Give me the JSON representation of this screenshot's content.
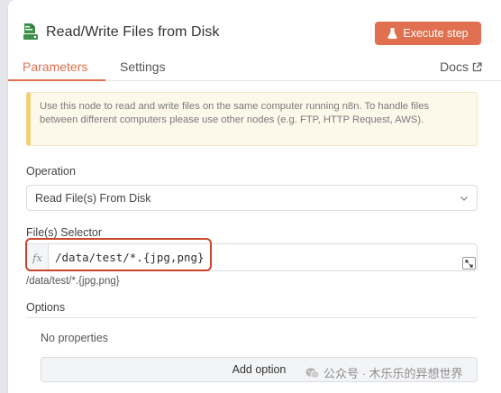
{
  "header": {
    "title": "Read/Write Files from Disk",
    "execute_label": "Execute step",
    "icon": "file-disk-icon",
    "accent": "#e0704f"
  },
  "tabs": {
    "parameters": "Parameters",
    "settings": "Settings",
    "docs": "Docs"
  },
  "notice": {
    "text": "Use this node to read and write files on the same computer running n8n. To handle files between different computers please use other nodes (e.g. FTP, HTTP Request, AWS)."
  },
  "operation": {
    "label": "Operation",
    "value": "Read File(s) From Disk"
  },
  "file_selector": {
    "label": "File(s) Selector",
    "fx": "fx",
    "expression": "/data/test/*.{jpg,png}",
    "resolved": "/data/test/*.{jpg,png}"
  },
  "options": {
    "label": "Options",
    "empty": "No properties",
    "add_label": "Add option"
  },
  "watermark": {
    "text": "公众号 · 木乐乐的异想世界"
  }
}
